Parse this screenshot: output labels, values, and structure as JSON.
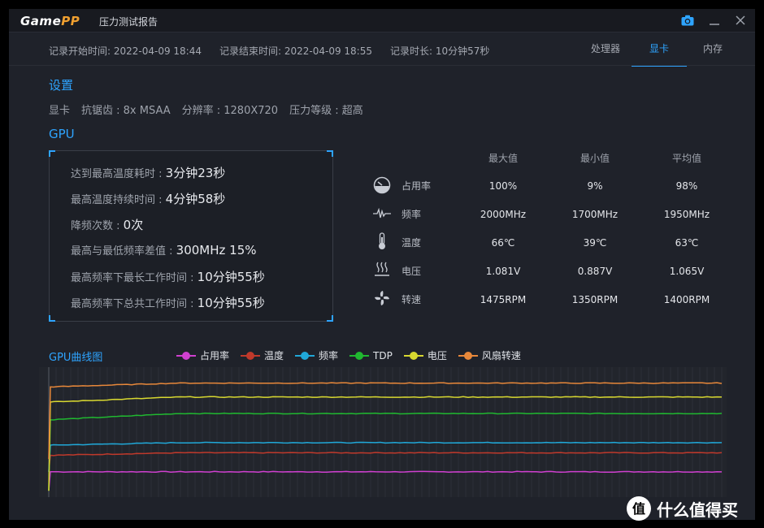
{
  "app": {
    "logo_part1": "Game",
    "logo_part2": "PP",
    "window_title": "压力测试报告"
  },
  "record": {
    "start": "记录开始时间: 2022-04-09 18:44",
    "end": "记录结束时间: 2022-04-09 18:55",
    "duration": "记录时长: 10分钟57秒"
  },
  "tabs": [
    {
      "label": "处理器",
      "active": false
    },
    {
      "label": "显卡",
      "active": true
    },
    {
      "label": "内存",
      "active": false
    }
  ],
  "settings": {
    "title": "设置",
    "items": [
      "显卡",
      "抗锯齿 : 8x MSAA",
      "分辨率 : 1280X720",
      "压力等级 : 超高"
    ]
  },
  "gpu": {
    "title": "GPU",
    "stats": [
      {
        "label": "达到最高温度耗时 : ",
        "value": "3分钟23秒"
      },
      {
        "label": "最高温度持续时间 : ",
        "value": "4分钟58秒"
      },
      {
        "label": "降频次数 : ",
        "value": "0次"
      },
      {
        "label": "最高与最低频率差值 : ",
        "value": "300MHz 15%"
      },
      {
        "label": "最高频率下最长工作时间 : ",
        "value": "10分钟55秒"
      },
      {
        "label": "最高频率下总共工作时间 : ",
        "value": "10分钟55秒"
      }
    ]
  },
  "metrics": {
    "headers": [
      "最大值",
      "最小值",
      "平均值"
    ],
    "rows": [
      {
        "icon": "usage-gauge-icon",
        "label": "占用率",
        "max": "100%",
        "min": "9%",
        "avg": "98%"
      },
      {
        "icon": "frequency-wave-icon",
        "label": "频率",
        "max": "2000MHz",
        "min": "1700MHz",
        "avg": "1950MHz"
      },
      {
        "icon": "thermometer-icon",
        "label": "温度",
        "max": "66℃",
        "min": "39℃",
        "avg": "63℃"
      },
      {
        "icon": "voltage-heat-icon",
        "label": "电压",
        "max": "1.081V",
        "min": "0.887V",
        "avg": "1.065V"
      },
      {
        "icon": "fan-icon",
        "label": "转速",
        "max": "1475RPM",
        "min": "1350RPM",
        "avg": "1400RPM"
      }
    ]
  },
  "chart_title": "GPU曲线图",
  "chart_data": {
    "type": "line",
    "title": "",
    "xlabel": "",
    "ylabel": "",
    "grid": true,
    "legend_position": "top",
    "series": [
      {
        "name": "占用率",
        "color": "#d040d0",
        "start": 0.05,
        "rise_to": 0.2,
        "plateau": 0.2
      },
      {
        "name": "温度",
        "color": "#c0392b",
        "start": 0.2,
        "rise_to": 0.33,
        "plateau": 0.35
      },
      {
        "name": "频率",
        "color": "#20a8d8",
        "start": 0.2,
        "rise_to": 0.41,
        "plateau": 0.43
      },
      {
        "name": "TDP",
        "color": "#20b830",
        "start": 0.05,
        "rise_to": 0.61,
        "plateau": 0.66
      },
      {
        "name": "电压",
        "color": "#d8d830",
        "start": 0.05,
        "rise_to": 0.75,
        "plateau": 0.79
      },
      {
        "name": "风扇转速",
        "color": "#e8883a",
        "start": 0.3,
        "rise_to": 0.87,
        "plateau": 0.9
      }
    ]
  },
  "watermark": {
    "icon_text": "值",
    "text": "什么值得买"
  }
}
